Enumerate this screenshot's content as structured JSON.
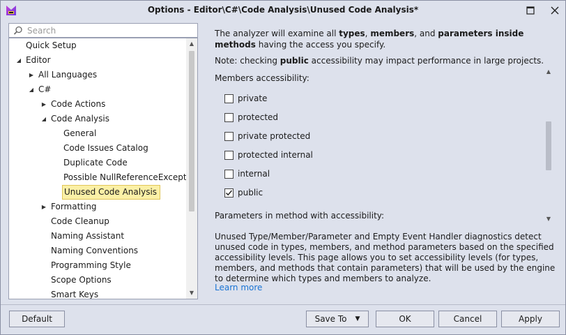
{
  "window": {
    "title": "Options - Editor\\C#\\Code Analysis\\Unused Code Analysis*"
  },
  "search": {
    "placeholder": "Search"
  },
  "tree": {
    "items": [
      {
        "label": "Quick Setup",
        "level": 0,
        "toggle": "",
        "selected": false
      },
      {
        "label": "Editor",
        "level": 0,
        "toggle": "expanded",
        "selected": false
      },
      {
        "label": "All Languages",
        "level": 1,
        "toggle": "collapsed",
        "selected": false
      },
      {
        "label": "C#",
        "level": 1,
        "toggle": "expanded",
        "selected": false
      },
      {
        "label": "Code Actions",
        "level": 2,
        "toggle": "collapsed",
        "selected": false
      },
      {
        "label": "Code Analysis",
        "level": 2,
        "toggle": "expanded",
        "selected": false
      },
      {
        "label": "General",
        "level": 3,
        "toggle": "",
        "selected": false
      },
      {
        "label": "Code Issues Catalog",
        "level": 3,
        "toggle": "",
        "selected": false
      },
      {
        "label": "Duplicate Code",
        "level": 3,
        "toggle": "",
        "selected": false
      },
      {
        "label": "Possible NullReferenceException",
        "level": 3,
        "toggle": "",
        "selected": false
      },
      {
        "label": "Unused Code Analysis",
        "level": 3,
        "toggle": "",
        "selected": true
      },
      {
        "label": "Formatting",
        "level": 2,
        "toggle": "collapsed",
        "selected": false
      },
      {
        "label": "Code Cleanup",
        "level": 2,
        "toggle": "",
        "selected": false
      },
      {
        "label": "Naming Assistant",
        "level": 2,
        "toggle": "",
        "selected": false
      },
      {
        "label": "Naming Conventions",
        "level": 2,
        "toggle": "",
        "selected": false
      },
      {
        "label": "Programming Style",
        "level": 2,
        "toggle": "",
        "selected": false
      },
      {
        "label": "Scope Options",
        "level": 2,
        "toggle": "",
        "selected": false
      },
      {
        "label": "Smart Keys",
        "level": 2,
        "toggle": "",
        "selected": false
      }
    ]
  },
  "content": {
    "description_parts": [
      {
        "text": "The analyzer will examine all ",
        "bold": false
      },
      {
        "text": "types",
        "bold": true
      },
      {
        "text": ", ",
        "bold": false
      },
      {
        "text": "members",
        "bold": true
      },
      {
        "text": ", and ",
        "bold": false
      },
      {
        "text": "parameters inside methods",
        "bold": true
      },
      {
        "text": " having the access you specify.",
        "bold": false
      }
    ],
    "note_parts": [
      {
        "text": "Note: checking ",
        "bold": false
      },
      {
        "text": "public",
        "bold": true
      },
      {
        "text": " accessibility may impact performance in large projects.",
        "bold": false
      }
    ],
    "members_label": "Members accessibility:",
    "checkboxes": [
      {
        "label": "private",
        "checked": false
      },
      {
        "label": "protected",
        "checked": false
      },
      {
        "label": "private protected",
        "checked": false
      },
      {
        "label": "protected internal",
        "checked": false
      },
      {
        "label": "internal",
        "checked": false
      },
      {
        "label": "public",
        "checked": true
      }
    ],
    "parameters_label": "Parameters in method with accessibility:",
    "footer_text": "Unused Type/Member/Parameter and Empty Event Handler diagnostics detect unused code in types, members, and method parameters based on the specified accessibility levels. This page allows you to set accessibility levels (for types, members, and methods that contain parameters) that will be used by the engine to determine which types and members to analyze.",
    "learn_more": "Learn more"
  },
  "buttons": {
    "default": "Default",
    "save_to": "Save To",
    "ok": "OK",
    "cancel": "Cancel",
    "apply": "Apply"
  },
  "colors": {
    "selection_bg": "#fbf0a6",
    "link": "#1a74d4",
    "window_bg": "#dde1ec"
  }
}
